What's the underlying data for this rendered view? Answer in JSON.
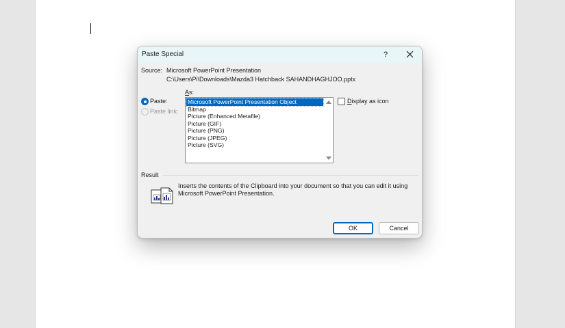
{
  "dialog": {
    "title": "Paste Special",
    "help_label": "?",
    "source_label": "Source:",
    "source_name": "Microsoft PowerPoint Presentation",
    "source_path": "C:\\Users\\Pi\\Downloads\\Mazda3 Hatchback SAHANDHAGHJOO.pptx",
    "as_label_first": "A",
    "as_label_rest": "s:",
    "paste_option": {
      "label": "Paste:",
      "selected": true
    },
    "paste_link_option": {
      "label": "Paste link:",
      "selected": false,
      "disabled": true
    },
    "as_list": {
      "items": [
        "Microsoft PowerPoint Presentation Object",
        "Bitmap",
        "Picture (Enhanced Metafile)",
        "Picture (GIF)",
        "Picture (PNG)",
        "Picture (JPEG)",
        "Picture (SVG)"
      ],
      "selected_index": 0
    },
    "display_as_icon": {
      "label_first": "D",
      "label_rest": "isplay as icon",
      "checked": false
    },
    "result_label": "Result",
    "result_text": "Inserts the contents of the Clipboard into your document so that you can edit it using Microsoft PowerPoint Presentation.",
    "ok_label": "OK",
    "cancel_label": "Cancel"
  },
  "colors": {
    "accent": "#0067c0",
    "titlebar": "#e8f6f7",
    "dialog_bg": "#f0f0f0"
  },
  "icons": [
    "close-icon",
    "result-clipboard-icon",
    "scroll-up-arrow-icon",
    "scroll-down-arrow-icon"
  ]
}
